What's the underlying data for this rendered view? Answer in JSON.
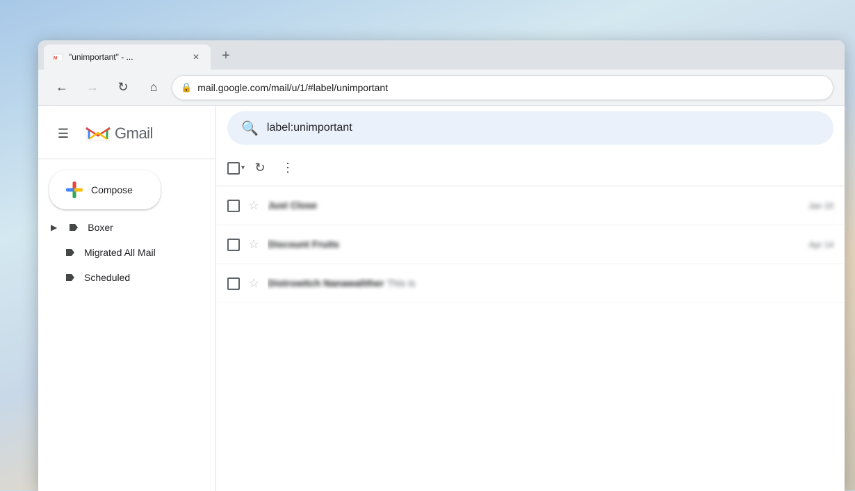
{
  "desktop": {
    "bg_desc": "sky clouds background"
  },
  "browser": {
    "tab": {
      "title": "\"unimportant\" - ...",
      "favicon_color_r": "#EA4335",
      "favicon_color_b": "#4285F4",
      "favicon_color_g": "#34A853",
      "favicon_color_y": "#FBBC04"
    },
    "new_tab_label": "+",
    "nav": {
      "back_icon": "←",
      "forward_icon": "→",
      "reload_icon": "↻",
      "home_icon": "⌂",
      "lock_icon": "🔒",
      "url": "mail.google.com/mail/u/1/#label/unimportant"
    }
  },
  "gmail": {
    "header": {
      "hamburger_icon": "☰",
      "logo_text": "Gmail"
    },
    "search": {
      "placeholder": "label:unimportant",
      "icon": "🔍"
    },
    "compose": {
      "label": "Compose",
      "plus_icon": "+"
    },
    "sidebar": {
      "items": [
        {
          "label": "Boxer",
          "icon": "tag",
          "expandable": true
        },
        {
          "label": "Migrated All Mail",
          "icon": "tag",
          "expandable": false
        },
        {
          "label": "Scheduled",
          "icon": "tag",
          "expandable": false
        }
      ]
    },
    "toolbar": {
      "select_all_icon": "☐",
      "dropdown_icon": "▾",
      "refresh_icon": "↻",
      "more_icon": "⋮"
    },
    "emails": [
      {
        "sender": "Just Close",
        "preview": "",
        "date": "Jan 10",
        "read": false
      },
      {
        "sender": "Discount Fruits",
        "preview": "",
        "date": "Apr 14",
        "read": false
      },
      {
        "sender": "Distrowitch Nanawalither",
        "preview": "This is",
        "date": "",
        "read": false
      }
    ]
  }
}
